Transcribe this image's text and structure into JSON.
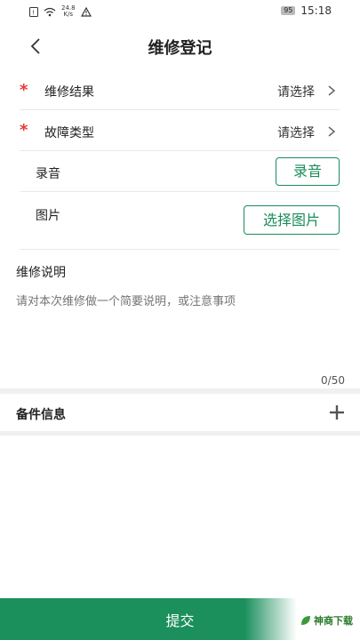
{
  "status_bar": {
    "speed_value": "24.8",
    "speed_unit": "K/s",
    "battery": "95",
    "time": "15:18"
  },
  "header": {
    "title": "维修登记"
  },
  "form": {
    "result": {
      "label": "维修结果",
      "value": "请选择"
    },
    "fault_type": {
      "label": "故障类型",
      "value": "请选择"
    },
    "recording": {
      "label": "录音",
      "button": "录音"
    },
    "image": {
      "label": "图片",
      "button": "选择图片"
    },
    "description": {
      "label": "维修说明",
      "placeholder": "请对本次维修做一个简要说明，或注意事项",
      "counter": "0/50"
    }
  },
  "parts": {
    "label": "备件信息"
  },
  "footer": {
    "submit": "提交",
    "logo_text": "神商下载"
  },
  "colors": {
    "accent": "#1b8f5c",
    "required": "#e53935"
  }
}
